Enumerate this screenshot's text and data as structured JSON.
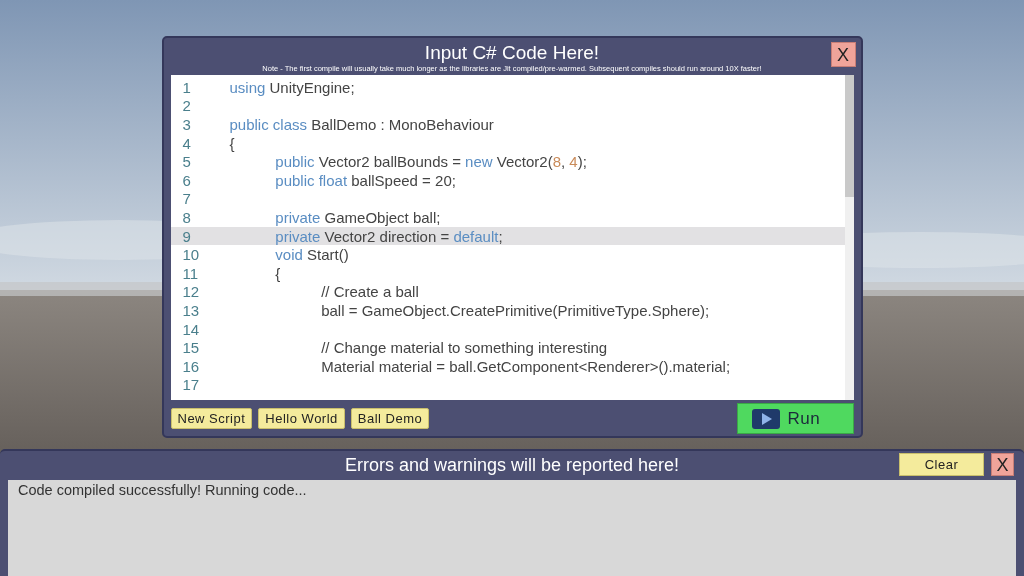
{
  "editor": {
    "title": "Input C# Code Here!",
    "note": "Note - The first compile will usually take much longer as the libraries are Jit compiled/pre-warmed. Subsequent compiles should run around 10X faster!",
    "close": "X",
    "lines": [
      {
        "number": "1",
        "highlighted": false,
        "tokens": [
          {
            "kind": "keyword",
            "text": "using"
          },
          {
            "kind": "plain",
            "text": " UnityEngine;"
          }
        ]
      },
      {
        "number": "2",
        "highlighted": false
      },
      {
        "number": "3",
        "highlighted": false,
        "tokens": [
          {
            "kind": "keyword",
            "text": "public class"
          },
          {
            "kind": "plain",
            "text": " BallDemo : MonoBehaviour"
          }
        ]
      },
      {
        "number": "4",
        "highlighted": false,
        "tokens": [
          {
            "kind": "plain",
            "text": "{"
          }
        ]
      },
      {
        "number": "5",
        "highlighted": false,
        "tokens": [
          {
            "kind": "keyword",
            "text": "\tpublic"
          },
          {
            "kind": "plain",
            "text": " Vector2 ballBounds = "
          },
          {
            "kind": "keyword",
            "text": "new"
          },
          {
            "kind": "plain",
            "text": " Vector2("
          },
          {
            "kind": "number",
            "text": "8"
          },
          {
            "kind": "plain",
            "text": ", "
          },
          {
            "kind": "number",
            "text": "4"
          },
          {
            "kind": "plain",
            "text": ");"
          }
        ]
      },
      {
        "number": "6",
        "highlighted": false,
        "tokens": [
          {
            "kind": "keyword",
            "text": "\tpublic float"
          },
          {
            "kind": "plain",
            "text": " ballSpeed = 20;"
          }
        ]
      },
      {
        "number": "7",
        "highlighted": false
      },
      {
        "number": "8",
        "highlighted": false,
        "tokens": [
          {
            "kind": "keyword",
            "text": "\tprivate"
          },
          {
            "kind": "plain",
            "text": " GameObject ball;"
          }
        ]
      },
      {
        "number": "9",
        "highlighted": true,
        "tokens": [
          {
            "kind": "keyword",
            "text": "\tprivate"
          },
          {
            "kind": "plain",
            "text": " Vector2 direction = "
          },
          {
            "kind": "keyword",
            "text": "default"
          },
          {
            "kind": "plain",
            "text": ";"
          }
        ]
      },
      {
        "number": "10",
        "highlighted": false,
        "tokens": [
          {
            "kind": "keyword",
            "text": "\tvoid"
          },
          {
            "kind": "plain",
            "text": " Start()"
          }
        ]
      },
      {
        "number": "11",
        "highlighted": false,
        "tokens": [
          {
            "kind": "plain",
            "text": "\t{"
          }
        ]
      },
      {
        "number": "12",
        "highlighted": false,
        "tokens": [
          {
            "kind": "plain",
            "text": "\t\t// Create a ball"
          }
        ]
      },
      {
        "number": "13",
        "highlighted": false,
        "tokens": [
          {
            "kind": "plain",
            "text": "\t\tball = GameObject.CreatePrimitive(PrimitiveType.Sphere);"
          }
        ]
      },
      {
        "number": "14",
        "highlighted": false
      },
      {
        "number": "15",
        "highlighted": false,
        "tokens": [
          {
            "kind": "plain",
            "text": "\t\t// Change material to something interesting"
          }
        ]
      },
      {
        "number": "16",
        "highlighted": false,
        "tokens": [
          {
            "kind": "plain",
            "text": "\t\tMaterial material = ball.GetComponent<Renderer>().material;"
          }
        ]
      },
      {
        "number": "17",
        "highlighted": false
      }
    ],
    "scripts": [
      "New Script",
      "Hello World",
      "Ball Demo"
    ],
    "run": "Run"
  },
  "console": {
    "title": "Errors and warnings will be reported here!",
    "clear": "Clear",
    "close": "X",
    "output": "Code compiled successfully! Running code..."
  }
}
